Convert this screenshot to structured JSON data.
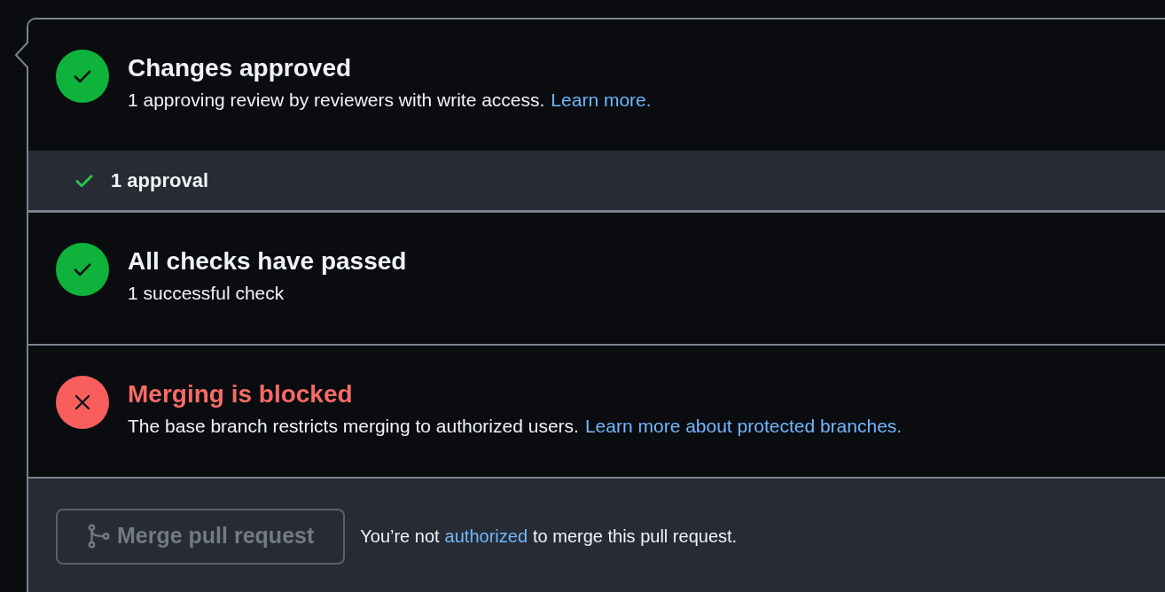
{
  "sections": [
    {
      "kind": "status",
      "passed": true,
      "title": "Changes approved",
      "description": "1 approving review by reviewers with write access.",
      "link": "Learn more."
    },
    {
      "kind": "detail",
      "passed": true,
      "text": "1 approval"
    },
    {
      "kind": "status",
      "passed": true,
      "title": "All checks have passed",
      "description": "1 successful check"
    },
    {
      "kind": "status",
      "passed": false,
      "title": "Merging is blocked",
      "description": "The base branch restricts merging to authorized users.",
      "link": "Learn more about protected branches."
    }
  ],
  "merge": {
    "button": {
      "label": "Merge pull request",
      "disabled": true
    },
    "note_before": "You’re not",
    "note_link": "authorized",
    "note_after": "to merge this pull request."
  }
}
